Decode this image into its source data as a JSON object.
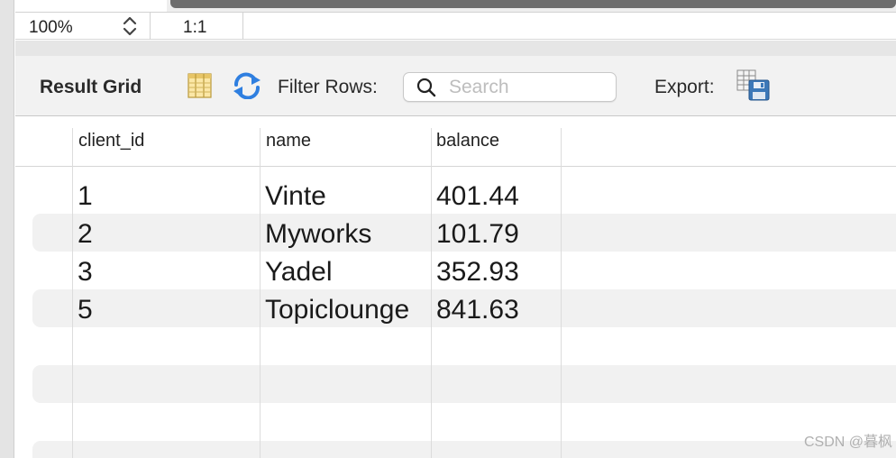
{
  "zoom": {
    "value": "100%",
    "ratio": "1:1"
  },
  "toolbar": {
    "title": "Result Grid",
    "filter_label": "Filter Rows:",
    "search_placeholder": "Search",
    "search_value": "",
    "export_label": "Export:",
    "icons": [
      "grid-view-icon",
      "refresh-icon",
      "search-icon",
      "export-icon"
    ]
  },
  "table": {
    "columns": [
      "client_id",
      "name",
      "balance"
    ],
    "rows": [
      [
        "1",
        "Vinte",
        "401.44"
      ],
      [
        "2",
        "Myworks",
        "101.79"
      ],
      [
        "3",
        "Yadel",
        "352.93"
      ],
      [
        "5",
        "Topiclounge",
        "841.63"
      ]
    ]
  },
  "watermark": "CSDN @暮枫",
  "colors": {
    "refresh_blue": "#2f7fe0",
    "thumb": "#6e6e6e",
    "band": "#f1f1f1"
  }
}
